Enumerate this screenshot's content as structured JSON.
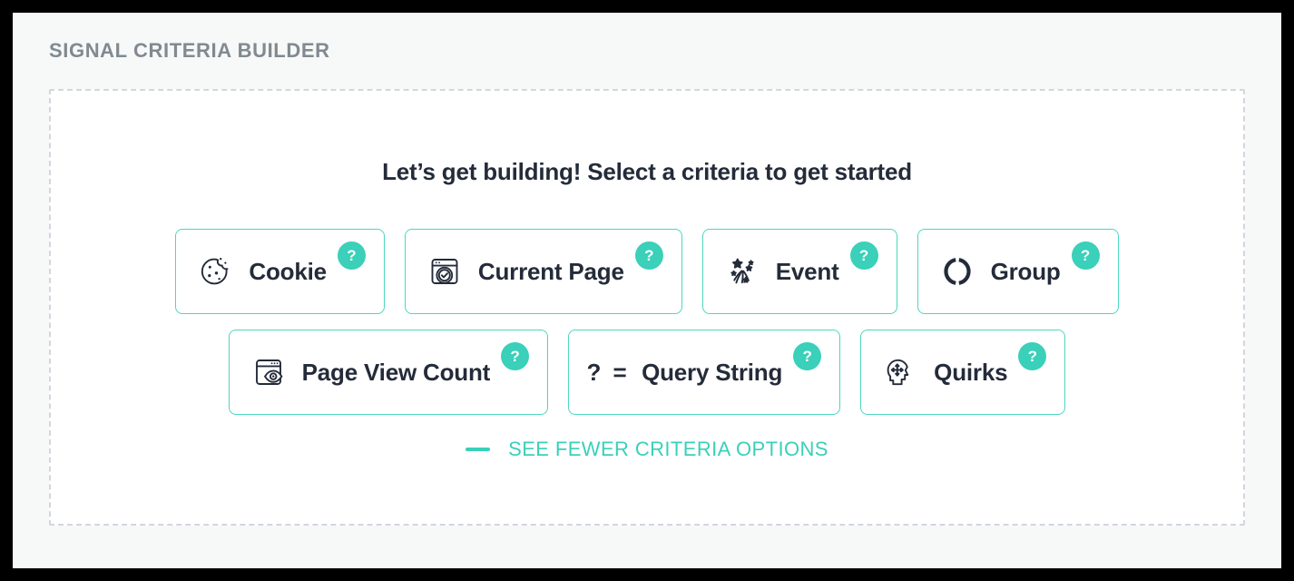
{
  "panel": {
    "title": "SIGNAL CRITERIA BUILDER",
    "prompt": "Let’s get building! Select a criteria to get started"
  },
  "theme": {
    "accent": "#3ad0b9",
    "card_border": "#4ed6bf",
    "text": "#242b39",
    "title_text": "#808a90",
    "page_bg": "#f7f8f8",
    "dashed_border": "#d3d6dd",
    "card_bg": "#ffffff"
  },
  "criteria": {
    "help_badge_label": "?",
    "rows": [
      [
        {
          "label": "Cookie",
          "icon": "cookie-icon"
        },
        {
          "label": "Current Page",
          "icon": "browser-check-icon"
        },
        {
          "label": "Event",
          "icon": "firework-icon"
        },
        {
          "label": "Group",
          "icon": "split-circle-icon"
        }
      ],
      [
        {
          "label": "Page View Count",
          "icon": "browser-eye-icon"
        },
        {
          "label": "Query String",
          "icon": "question-equals-icon",
          "icon_text": "? ="
        },
        {
          "label": "Quirks",
          "icon": "head-arrows-icon"
        }
      ]
    ]
  },
  "toggle": {
    "label": "SEE FEWER CRITERIA OPTIONS",
    "icon": "minus-icon"
  }
}
